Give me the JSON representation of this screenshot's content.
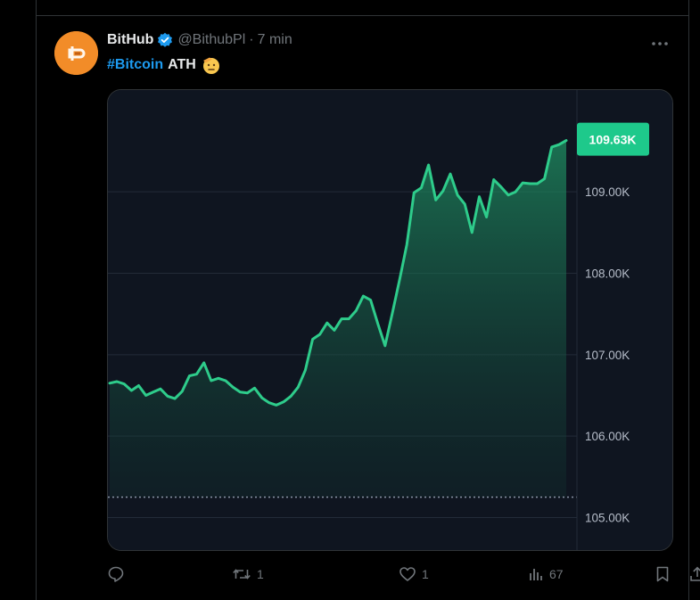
{
  "tweet": {
    "author_name": "BitHub",
    "handle": "@BithubPl",
    "separator": "·",
    "time": "7 min",
    "hashtag": "#Bitcoin",
    "text": "ATH",
    "emoji": "saluting-face"
  },
  "actions": {
    "replies": "",
    "retweets": "1",
    "likes": "1",
    "views": "67"
  },
  "chart_data": {
    "type": "area",
    "price_label": "109.63K",
    "y_tick_labels": [
      "109.00K",
      "108.00K",
      "107.00K",
      "106.00K",
      "105.00K"
    ],
    "y_ticks": [
      109000,
      108000,
      107000,
      106000,
      105000
    ],
    "ylim": [
      104600,
      110250
    ],
    "reference_line": 105250,
    "grid": true,
    "line_color": "#2ecc8b",
    "label_color": "#1ec98b",
    "values": [
      106650,
      106670,
      106640,
      106560,
      106620,
      106500,
      106540,
      106580,
      106490,
      106460,
      106550,
      106740,
      106760,
      106900,
      106680,
      106710,
      106680,
      106600,
      106540,
      106530,
      106590,
      106470,
      106410,
      106380,
      106420,
      106490,
      106600,
      106810,
      107190,
      107250,
      107390,
      107300,
      107440,
      107440,
      107540,
      107720,
      107670,
      107380,
      107110,
      107510,
      107920,
      108350,
      108990,
      109050,
      109330,
      108900,
      109010,
      109220,
      108960,
      108850,
      108500,
      108940,
      108690,
      109150,
      109060,
      108960,
      109000,
      109110,
      109100,
      109100,
      109160,
      109550,
      109580,
      109630
    ]
  }
}
